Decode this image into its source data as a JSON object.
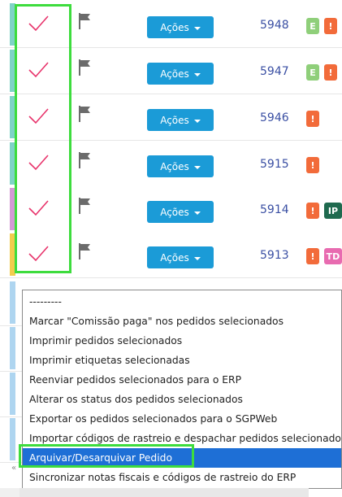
{
  "rows": [
    {
      "id": "5948",
      "stripe": "#7fd3c7",
      "badges": [
        {
          "text": "E",
          "color": "#8fcf7a"
        },
        {
          "text": "!",
          "color": "#f26b3a"
        }
      ]
    },
    {
      "id": "5947",
      "stripe": "#7fd3c7",
      "badges": [
        {
          "text": "E",
          "color": "#8fcf7a"
        },
        {
          "text": "!",
          "color": "#f26b3a"
        }
      ]
    },
    {
      "id": "5946",
      "stripe": "#7fd3c7",
      "badges": [
        {
          "text": "!",
          "color": "#f26b3a"
        }
      ]
    },
    {
      "id": "5915",
      "stripe": "#7fd3c7",
      "badges": [
        {
          "text": "!",
          "color": "#f26b3a"
        }
      ]
    },
    {
      "id": "5914",
      "stripe": "#d39ad6",
      "badges": [
        {
          "text": "!",
          "color": "#f26b3a"
        },
        {
          "text": "IP",
          "color": "#1f6a4f"
        }
      ]
    },
    {
      "id": "5913",
      "stripe": "#f2cc4e",
      "badges": [
        {
          "text": "!",
          "color": "#f26b3a"
        },
        {
          "text": "TD",
          "color": "#e86bb0"
        }
      ]
    }
  ],
  "acoes_label": "Ações",
  "dropdown": {
    "items": [
      "---------",
      "Marcar \"Comissão paga\" nos pedidos selecionados",
      "Imprimir pedidos selecionados",
      "Imprimir etiquetas selecionadas",
      "Reenviar pedidos selecionados para o ERP",
      "Alterar os status dos pedidos selecionados",
      "Exportar os pedidos selecionados para o SGPWeb",
      "Importar códigos de rastreio e despachar pedidos selecionados.",
      "Arquivar/Desarquivar Pedido",
      "Sincronizar notas fiscais e códigos de rastreio do ERP"
    ],
    "selected_index": 8
  },
  "colors": {
    "check": "#e8336b",
    "flag": "#6b6b6b",
    "button": "#1b9bd7",
    "highlight": "#3ddc3d",
    "selected": "#1e6fd6"
  },
  "icons": {
    "check": "checkmark-icon",
    "flag": "flag-icon",
    "caret": "caret-down-icon"
  }
}
